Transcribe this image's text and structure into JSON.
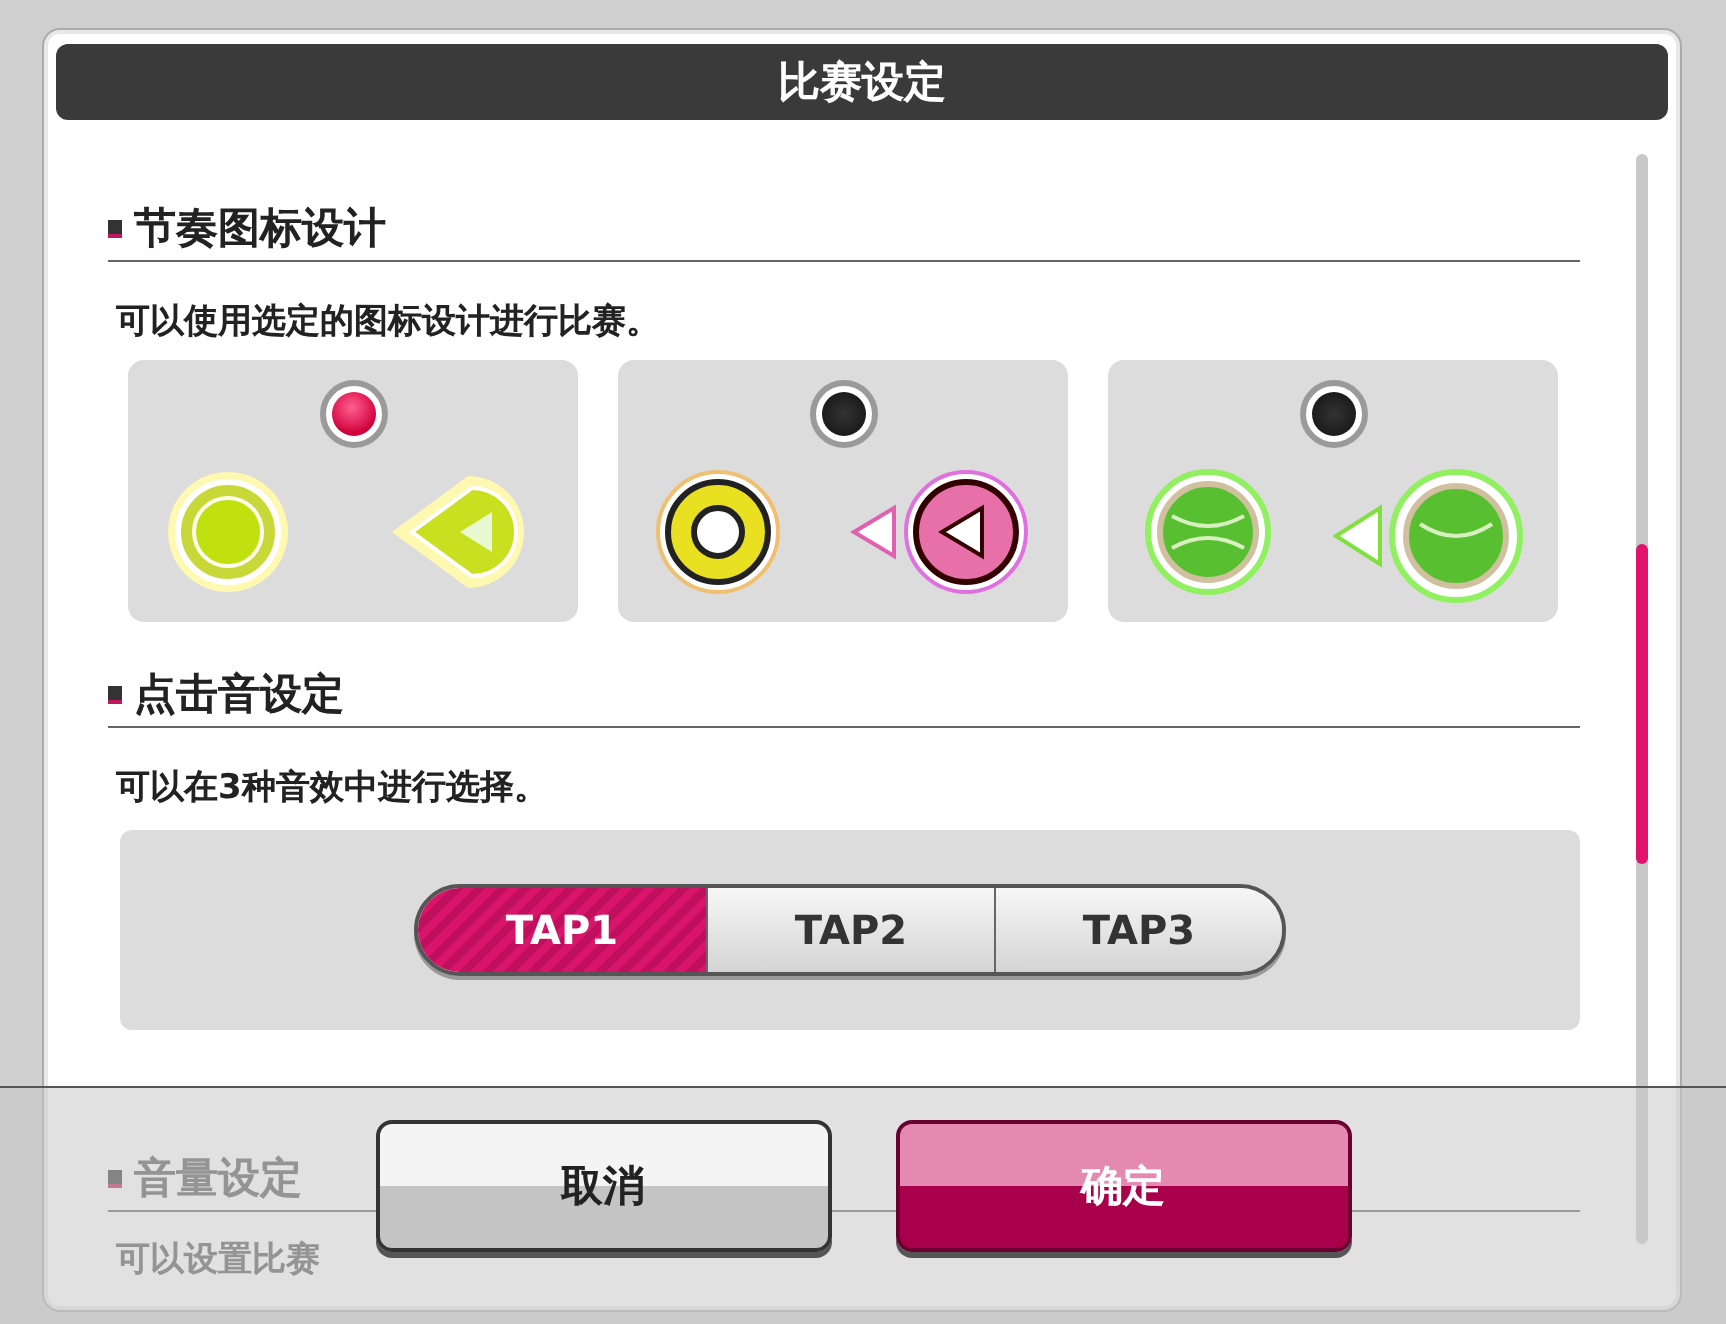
{
  "dialog": {
    "title": "比赛设定"
  },
  "icon_section": {
    "heading": "节奏图标设计",
    "description": "可以使用选定的图标设计进行比赛。",
    "designs": [
      {
        "kind": "yellow",
        "selected": true
      },
      {
        "kind": "ring",
        "selected": false
      },
      {
        "kind": "tennis",
        "selected": false
      }
    ]
  },
  "tap_section": {
    "heading": "点击音设定",
    "description": "可以在3种音效中进行选择。",
    "options": [
      {
        "label": "TAP1",
        "selected": true
      },
      {
        "label": "TAP2",
        "selected": false
      },
      {
        "label": "TAP3",
        "selected": false
      }
    ]
  },
  "volume_section": {
    "heading": "音量设定",
    "description": "可以设置比赛"
  },
  "buttons": [
    {
      "label": "取消",
      "kind": "cancel"
    },
    {
      "label": "确定",
      "kind": "confirm"
    }
  ]
}
